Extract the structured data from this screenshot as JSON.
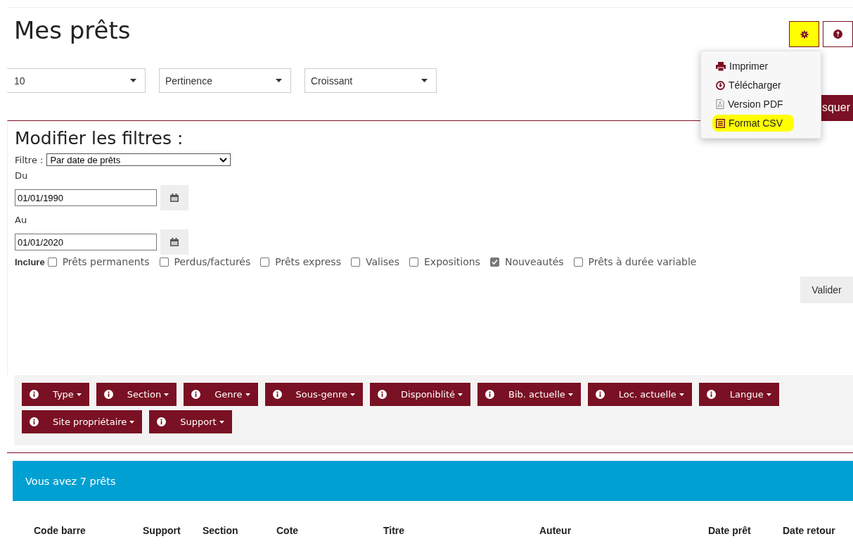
{
  "title": "Mes prêts",
  "toolbar": {
    "settings_highlighted": true
  },
  "menu": [
    {
      "kind": "print",
      "label": "Imprimer",
      "highlighted": false
    },
    {
      "kind": "download",
      "label": "Télécharger",
      "highlighted": false
    },
    {
      "kind": "pdf",
      "label": "Version PDF",
      "highlighted": false
    },
    {
      "kind": "csv",
      "label": "Format CSV",
      "highlighted": true
    }
  ],
  "sort": [
    {
      "value": "10"
    },
    {
      "value": "Pertinence"
    },
    {
      "value": "Croissant"
    }
  ],
  "hide_button": "squer",
  "filters": {
    "heading": "Modifier les filtres :",
    "filter_label": "Filtre :",
    "filter_value": "Par date de prêts",
    "from_label": "Du",
    "from_value": "01/01/1990",
    "to_label": "Au",
    "to_value": "01/01/2020",
    "include_label": "Inclure",
    "options": [
      {
        "label": "Prêts permanents",
        "checked": false
      },
      {
        "label": "Perdus/facturés",
        "checked": false
      },
      {
        "label": "Prêts express",
        "checked": false
      },
      {
        "label": "Valises",
        "checked": false
      },
      {
        "label": "Expositions",
        "checked": false
      },
      {
        "label": "Nouveautés",
        "checked": true
      },
      {
        "label": "Prêts à durée variable",
        "checked": false
      }
    ],
    "submit": "Valider"
  },
  "facets": [
    "Type",
    "Section",
    "Genre",
    "Sous-genre",
    "Disponiblité",
    "Bib. actuelle",
    "Loc. actuelle",
    "Langue",
    "Site propriétaire",
    "Support"
  ],
  "banner": "Vous avez 7 prêts",
  "table": {
    "columns": [
      "Code barre",
      "Support",
      "Section",
      "Cote",
      "Titre",
      "Auteur",
      "Date prêt",
      "Date retour"
    ]
  }
}
